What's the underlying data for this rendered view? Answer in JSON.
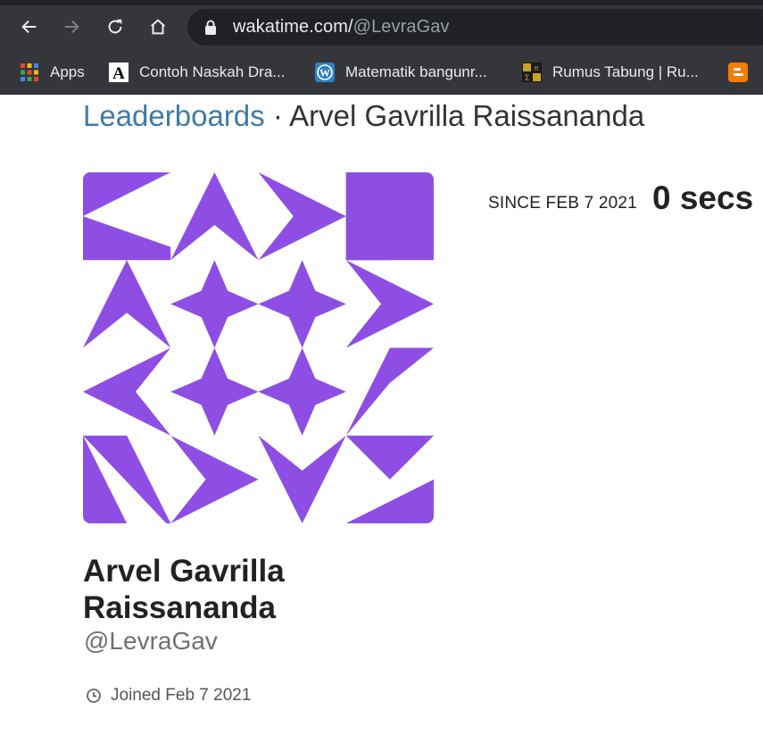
{
  "browser": {
    "url_domain": "wakatime.com/",
    "url_path": "@LevraGav",
    "bookmarks": [
      {
        "label": "Apps",
        "icon": "apps-grid-icon"
      },
      {
        "label": "Contoh Naskah Dra...",
        "icon": "letter-a-icon"
      },
      {
        "label": "Matematik bangunr...",
        "icon": "wordpress-icon"
      },
      {
        "label": "Rumus Tabung | Ru...",
        "icon": "math-symbols-icon"
      },
      {
        "label": "",
        "icon": "blogger-icon"
      }
    ]
  },
  "page": {
    "breadcrumb_link": "Leaderboards",
    "breadcrumb_separator": " · ",
    "breadcrumb_current": "Arvel Gavrilla Raissananda",
    "since_label": "SINCE FEB 7 2021",
    "total_time": "0 secs",
    "full_name": "Arvel Gavrilla Raissananda",
    "username": "@LevraGav",
    "joined": "Joined Feb 7 2021",
    "avatar_color": "#8e4ee4"
  }
}
